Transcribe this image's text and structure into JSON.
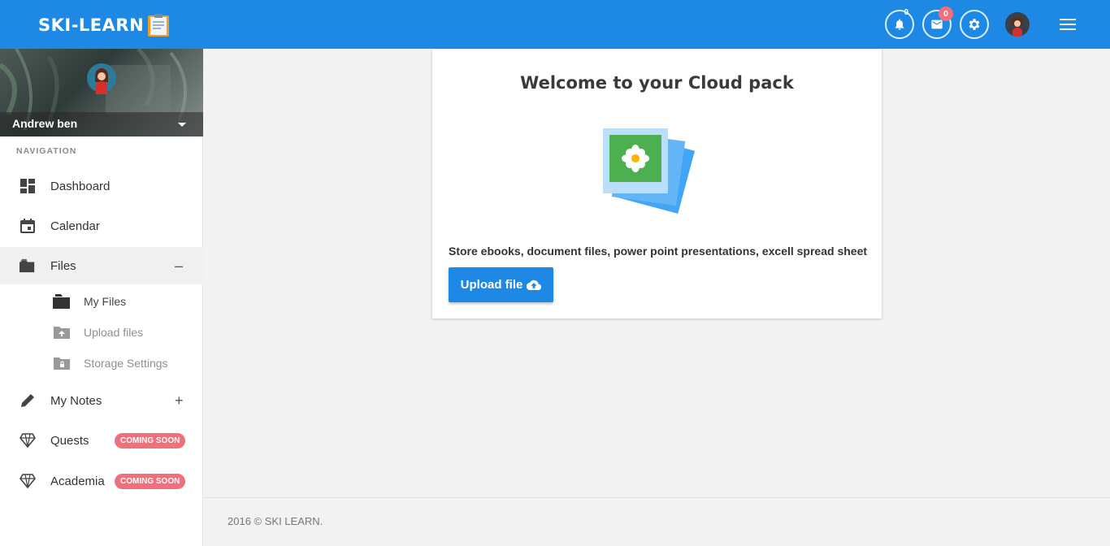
{
  "header": {
    "brand": "SKI-LEARN",
    "notifications_count": "0",
    "messages_count": "0",
    "icons": [
      "bell-icon",
      "mail-icon",
      "gear-icon",
      "avatar",
      "menu-icon"
    ],
    "colors": {
      "topbar": "#1e88e5",
      "badge": "#ef6f7a"
    }
  },
  "sidebar": {
    "user_name": "Andrew ben",
    "nav_heading": "NAVIGATION",
    "items": [
      {
        "label": "Dashboard",
        "icon": "dashboard-icon"
      },
      {
        "label": "Calendar",
        "icon": "calendar-icon"
      },
      {
        "label": "Files",
        "icon": "folder-icon",
        "toggle": "–",
        "active": true
      },
      {
        "label": "My Notes",
        "icon": "pencil-icon",
        "toggle": "+"
      },
      {
        "label": "Quests",
        "icon": "diamond-icon",
        "badge": "COMING SOON"
      },
      {
        "label": "Academia",
        "icon": "diamond-icon",
        "badge": "COMING SOON"
      }
    ],
    "files_sub": [
      {
        "label": "My Files",
        "icon": "folder-icon"
      },
      {
        "label": "Upload files",
        "icon": "folder-upload-icon"
      },
      {
        "label": "Storage Settings",
        "icon": "folder-lock-icon"
      }
    ]
  },
  "main": {
    "title": "Welcome to your Cloud pack",
    "description": "Store ebooks, document files, power point presentations, excell spread sheet",
    "upload_label": "Upload file"
  },
  "footer": {
    "text": "2016 © SKI LEARN."
  }
}
